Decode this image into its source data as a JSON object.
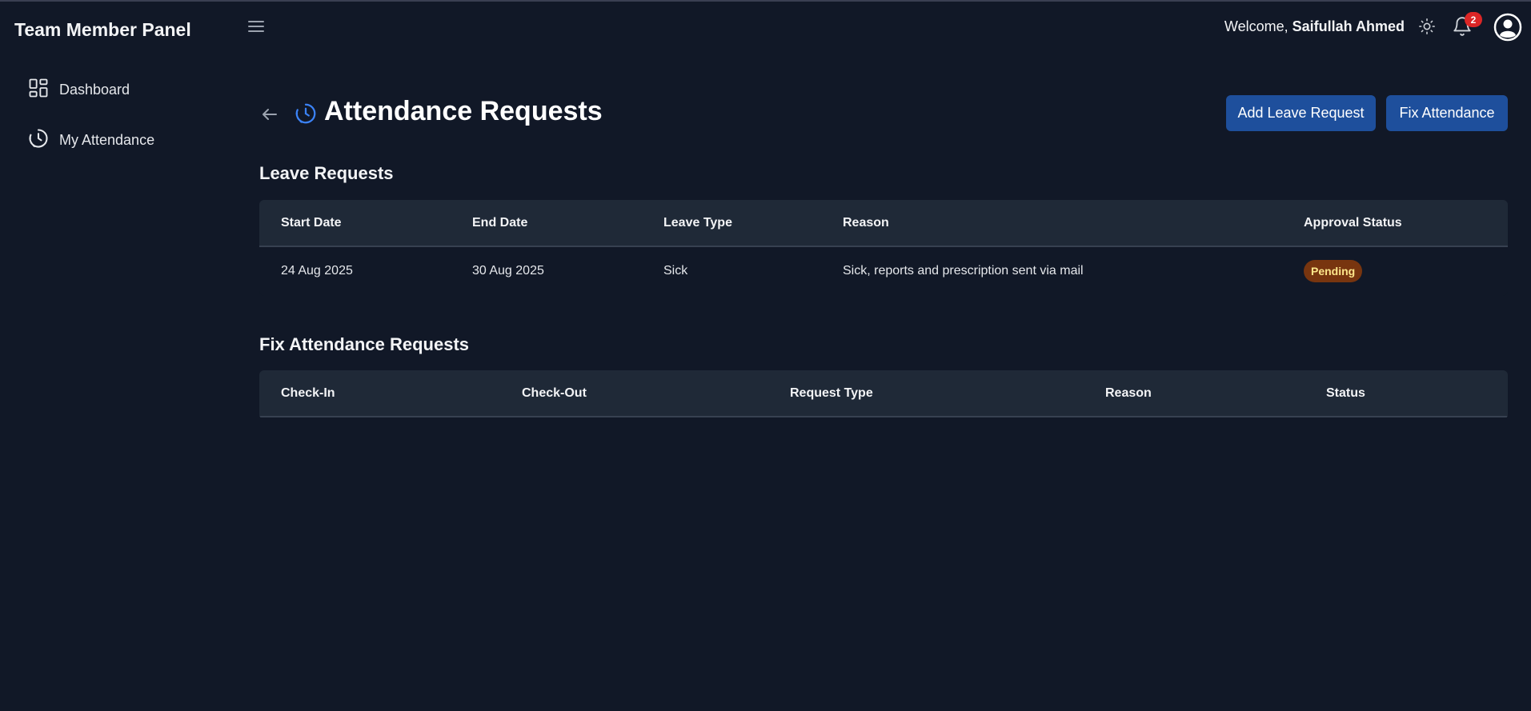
{
  "sidebar": {
    "brand": "Team Member Panel",
    "items": [
      {
        "label": "Dashboard",
        "icon": "dashboard-grid-icon"
      },
      {
        "label": "My Attendance",
        "icon": "clock-icon"
      }
    ]
  },
  "header": {
    "welcome_prefix": "Welcome,",
    "user_name": "Saifullah Ahmed",
    "notification_count": "2"
  },
  "page": {
    "title": "Attendance Requests",
    "add_leave_label": "Add Leave Request",
    "fix_attendance_label": "Fix Attendance"
  },
  "leave_requests": {
    "title": "Leave Requests",
    "columns": [
      "Start Date",
      "End Date",
      "Leave Type",
      "Reason",
      "Approval Status"
    ],
    "rows": [
      {
        "start": "24 Aug 2025",
        "end": "30 Aug 2025",
        "type": "Sick",
        "reason": "Sick, reports and prescription sent via mail",
        "status": "Pending"
      }
    ]
  },
  "fix_requests": {
    "title": "Fix Attendance Requests",
    "columns": [
      "Check-In",
      "Check-Out",
      "Request Type",
      "Reason",
      "Status"
    ],
    "rows": []
  },
  "colors": {
    "background": "#111827",
    "table_header": "#1f2937",
    "primary_button": "#1e4f9c",
    "pending_badge": "#78350f",
    "notification_badge": "#dc2626"
  }
}
